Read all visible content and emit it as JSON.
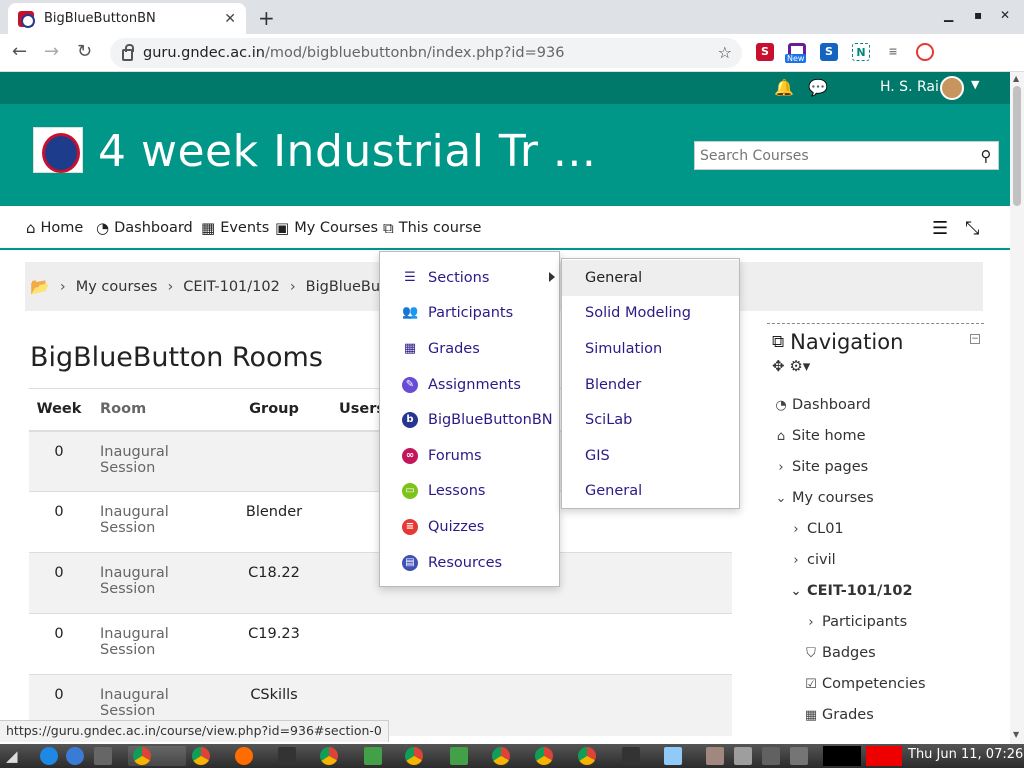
{
  "browser": {
    "tab_title": "BigBlueButtonBN",
    "tab_close": "✕",
    "new_tab": "+",
    "url_host": "guru.gndec.ac.in",
    "url_path": "/mod/bigbluebuttonbn/index.php?id=936",
    "ext_badge": "New",
    "status_url": "https://guru.gndec.ac.in/course/view.php?id=936#section-0"
  },
  "topbar": {
    "user_name": "H. S. Rai"
  },
  "header": {
    "course_title": "4 week Industrial Tr ...",
    "search_placeholder": "Search Courses"
  },
  "menu": {
    "items": [
      {
        "label": "Home",
        "icon": "home-icon"
      },
      {
        "label": "Dashboard",
        "icon": "dashboard-icon"
      },
      {
        "label": "Events",
        "icon": "calendar-icon"
      },
      {
        "label": "My Courses",
        "icon": "briefcase-icon"
      },
      {
        "label": "This course",
        "icon": "sitemap-icon"
      }
    ]
  },
  "breadcrumb": {
    "items": [
      "My courses",
      "CEIT-101/102",
      "BigBlueButton"
    ]
  },
  "page_title": "BigBlueButton Rooms",
  "table": {
    "headers": [
      "Week",
      "Room",
      "Group",
      "Users"
    ],
    "rows": [
      {
        "week": "0",
        "room": "Inaugural Session",
        "group": ""
      },
      {
        "week": "0",
        "room": "Inaugural Session",
        "group": "Blender"
      },
      {
        "week": "0",
        "room": "Inaugural Session",
        "group": "C18.22"
      },
      {
        "week": "0",
        "room": "Inaugural Session",
        "group": "C19.23"
      },
      {
        "week": "0",
        "room": "Inaugural Session",
        "group": "CSkills"
      }
    ]
  },
  "dropdown": {
    "items": [
      {
        "label": "Sections",
        "icon": "list-icon",
        "color": "#2c1a87"
      },
      {
        "label": "Participants",
        "icon": "users-icon",
        "color": "#2c1a87"
      },
      {
        "label": "Grades",
        "icon": "table-icon",
        "color": "#2c1a87"
      },
      {
        "label": "Assignments",
        "icon": "assignment-icon",
        "color": "#6a4bd6"
      },
      {
        "label": "BigBlueButtonBN",
        "icon": "bigbluebutton-icon",
        "color": "#283593"
      },
      {
        "label": "Forums",
        "icon": "forum-icon",
        "color": "#c2185b"
      },
      {
        "label": "Lessons",
        "icon": "lesson-icon",
        "color": "#7cc31b"
      },
      {
        "label": "Quizzes",
        "icon": "quiz-icon",
        "color": "#e53935"
      },
      {
        "label": "Resources",
        "icon": "resource-icon",
        "color": "#3f51b5"
      }
    ],
    "submenu": [
      "General",
      "Solid Modeling",
      "Simulation",
      "Blender",
      "SciLab",
      "GIS",
      "General"
    ]
  },
  "navigation": {
    "title": "Navigation",
    "items": [
      {
        "label": "Dashboard",
        "icon": "dashboard-icon"
      },
      {
        "label": "Site home",
        "icon": "home-icon"
      },
      {
        "label": "Site pages",
        "icon": "chevron-right-icon"
      },
      {
        "label": "My courses",
        "icon": "chevron-down-icon"
      },
      {
        "label": "CL01",
        "icon": "chevron-right-icon"
      },
      {
        "label": "civil",
        "icon": "chevron-right-icon"
      },
      {
        "label": "CEIT-101/102",
        "icon": "chevron-down-icon"
      },
      {
        "label": "Participants",
        "icon": "chevron-right-icon"
      },
      {
        "label": "Badges",
        "icon": "shield-icon"
      },
      {
        "label": "Competencies",
        "icon": "checkbox-icon"
      },
      {
        "label": "Grades",
        "icon": "table-icon"
      }
    ]
  },
  "taskbar": {
    "clock": "Thu Jun 11, 07:26"
  },
  "colors": {
    "header": "#009688",
    "topbar": "#00796b",
    "link": "#2c1a87"
  }
}
